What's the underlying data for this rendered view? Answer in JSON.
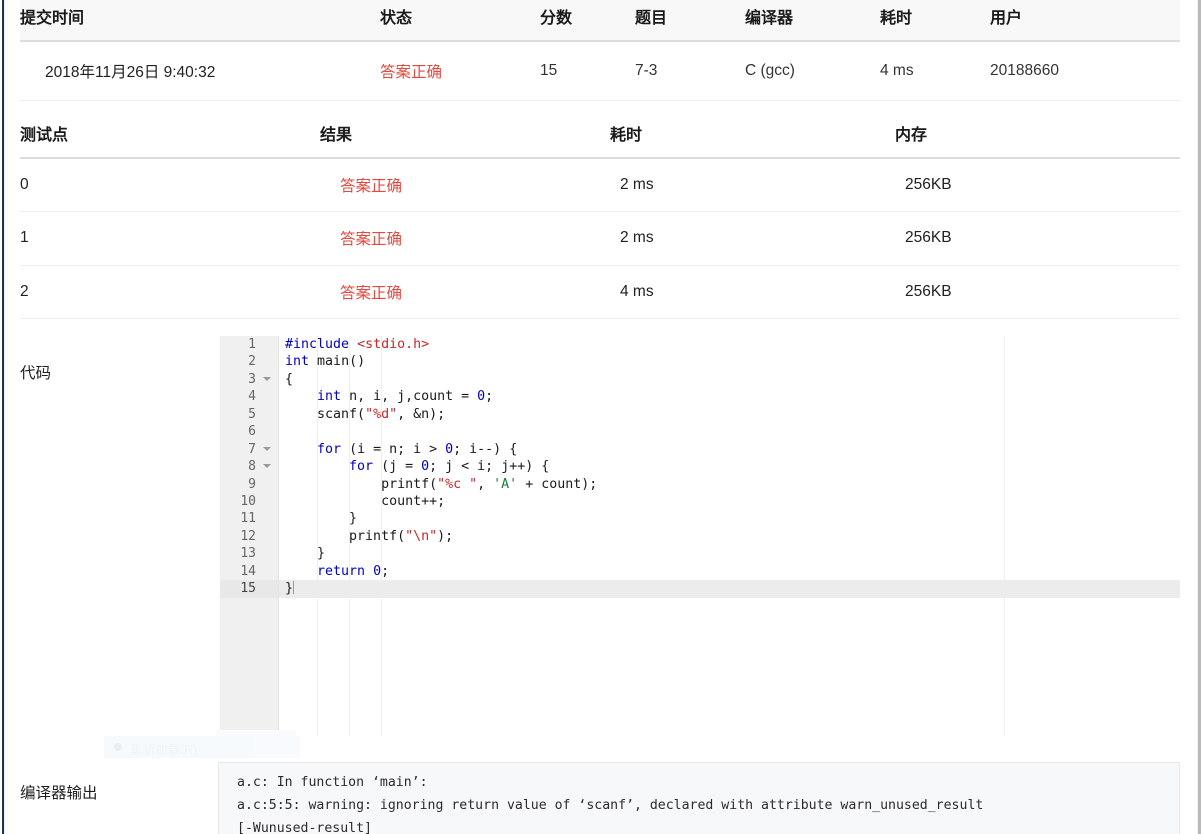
{
  "submission": {
    "headers": [
      "提交时间",
      "状态",
      "分数",
      "题目",
      "编译器",
      "耗时",
      "用户"
    ],
    "row": {
      "time": "2018年11月26日 9:40:32",
      "status": "答案正确",
      "score": "15",
      "problem": "7-3",
      "compiler": "C (gcc)",
      "duration": "4 ms",
      "user": "20188660"
    }
  },
  "testpoints": {
    "headers": [
      "测试点",
      "结果",
      "耗时",
      "内存"
    ],
    "rows": [
      {
        "id": "0",
        "result": "答案正确",
        "time": "2 ms",
        "memory": "256KB"
      },
      {
        "id": "1",
        "result": "答案正确",
        "time": "2 ms",
        "memory": "256KB"
      },
      {
        "id": "2",
        "result": "答案正确",
        "time": "4 ms",
        "memory": "256KB"
      }
    ]
  },
  "code_section": {
    "label": "代码",
    "line_numbers": [
      "1",
      "2",
      "3",
      "4",
      "5",
      "6",
      "7",
      "8",
      "9",
      "10",
      "11",
      "12",
      "13",
      "14",
      "15"
    ],
    "fold_markers": [
      3,
      7,
      8
    ],
    "active_line": 15,
    "lines": [
      "#include <stdio.h>",
      "int main()",
      "{",
      "    int n, i, j,count = 0;",
      "    scanf(\"%d\", &n);",
      "",
      "    for (i = n; i > 0; i--) {",
      "        for (j = 0; j < i; j++) {",
      "            printf(\"%c \", 'A' + count);",
      "            count++;",
      "        }",
      "        printf(\"\\n\");",
      "    }",
      "    return 0;",
      "}"
    ]
  },
  "compiler_output": {
    "label": "编译器输出",
    "lines": [
      "a.c: In function ‘main’:",
      "a.c:5:5: warning: ignoring return value of ‘scanf’, declared with attribute warn_unused_result",
      "[-Wunused-result]"
    ]
  },
  "ghost_menu": {
    "label": "重新加载(R)"
  },
  "colors": {
    "status_red": "#e04a3f",
    "header_bg": "#f8f8f8",
    "rail": "#23305a",
    "gutter": "#f0f0f0",
    "active_line": "#ececec"
  }
}
